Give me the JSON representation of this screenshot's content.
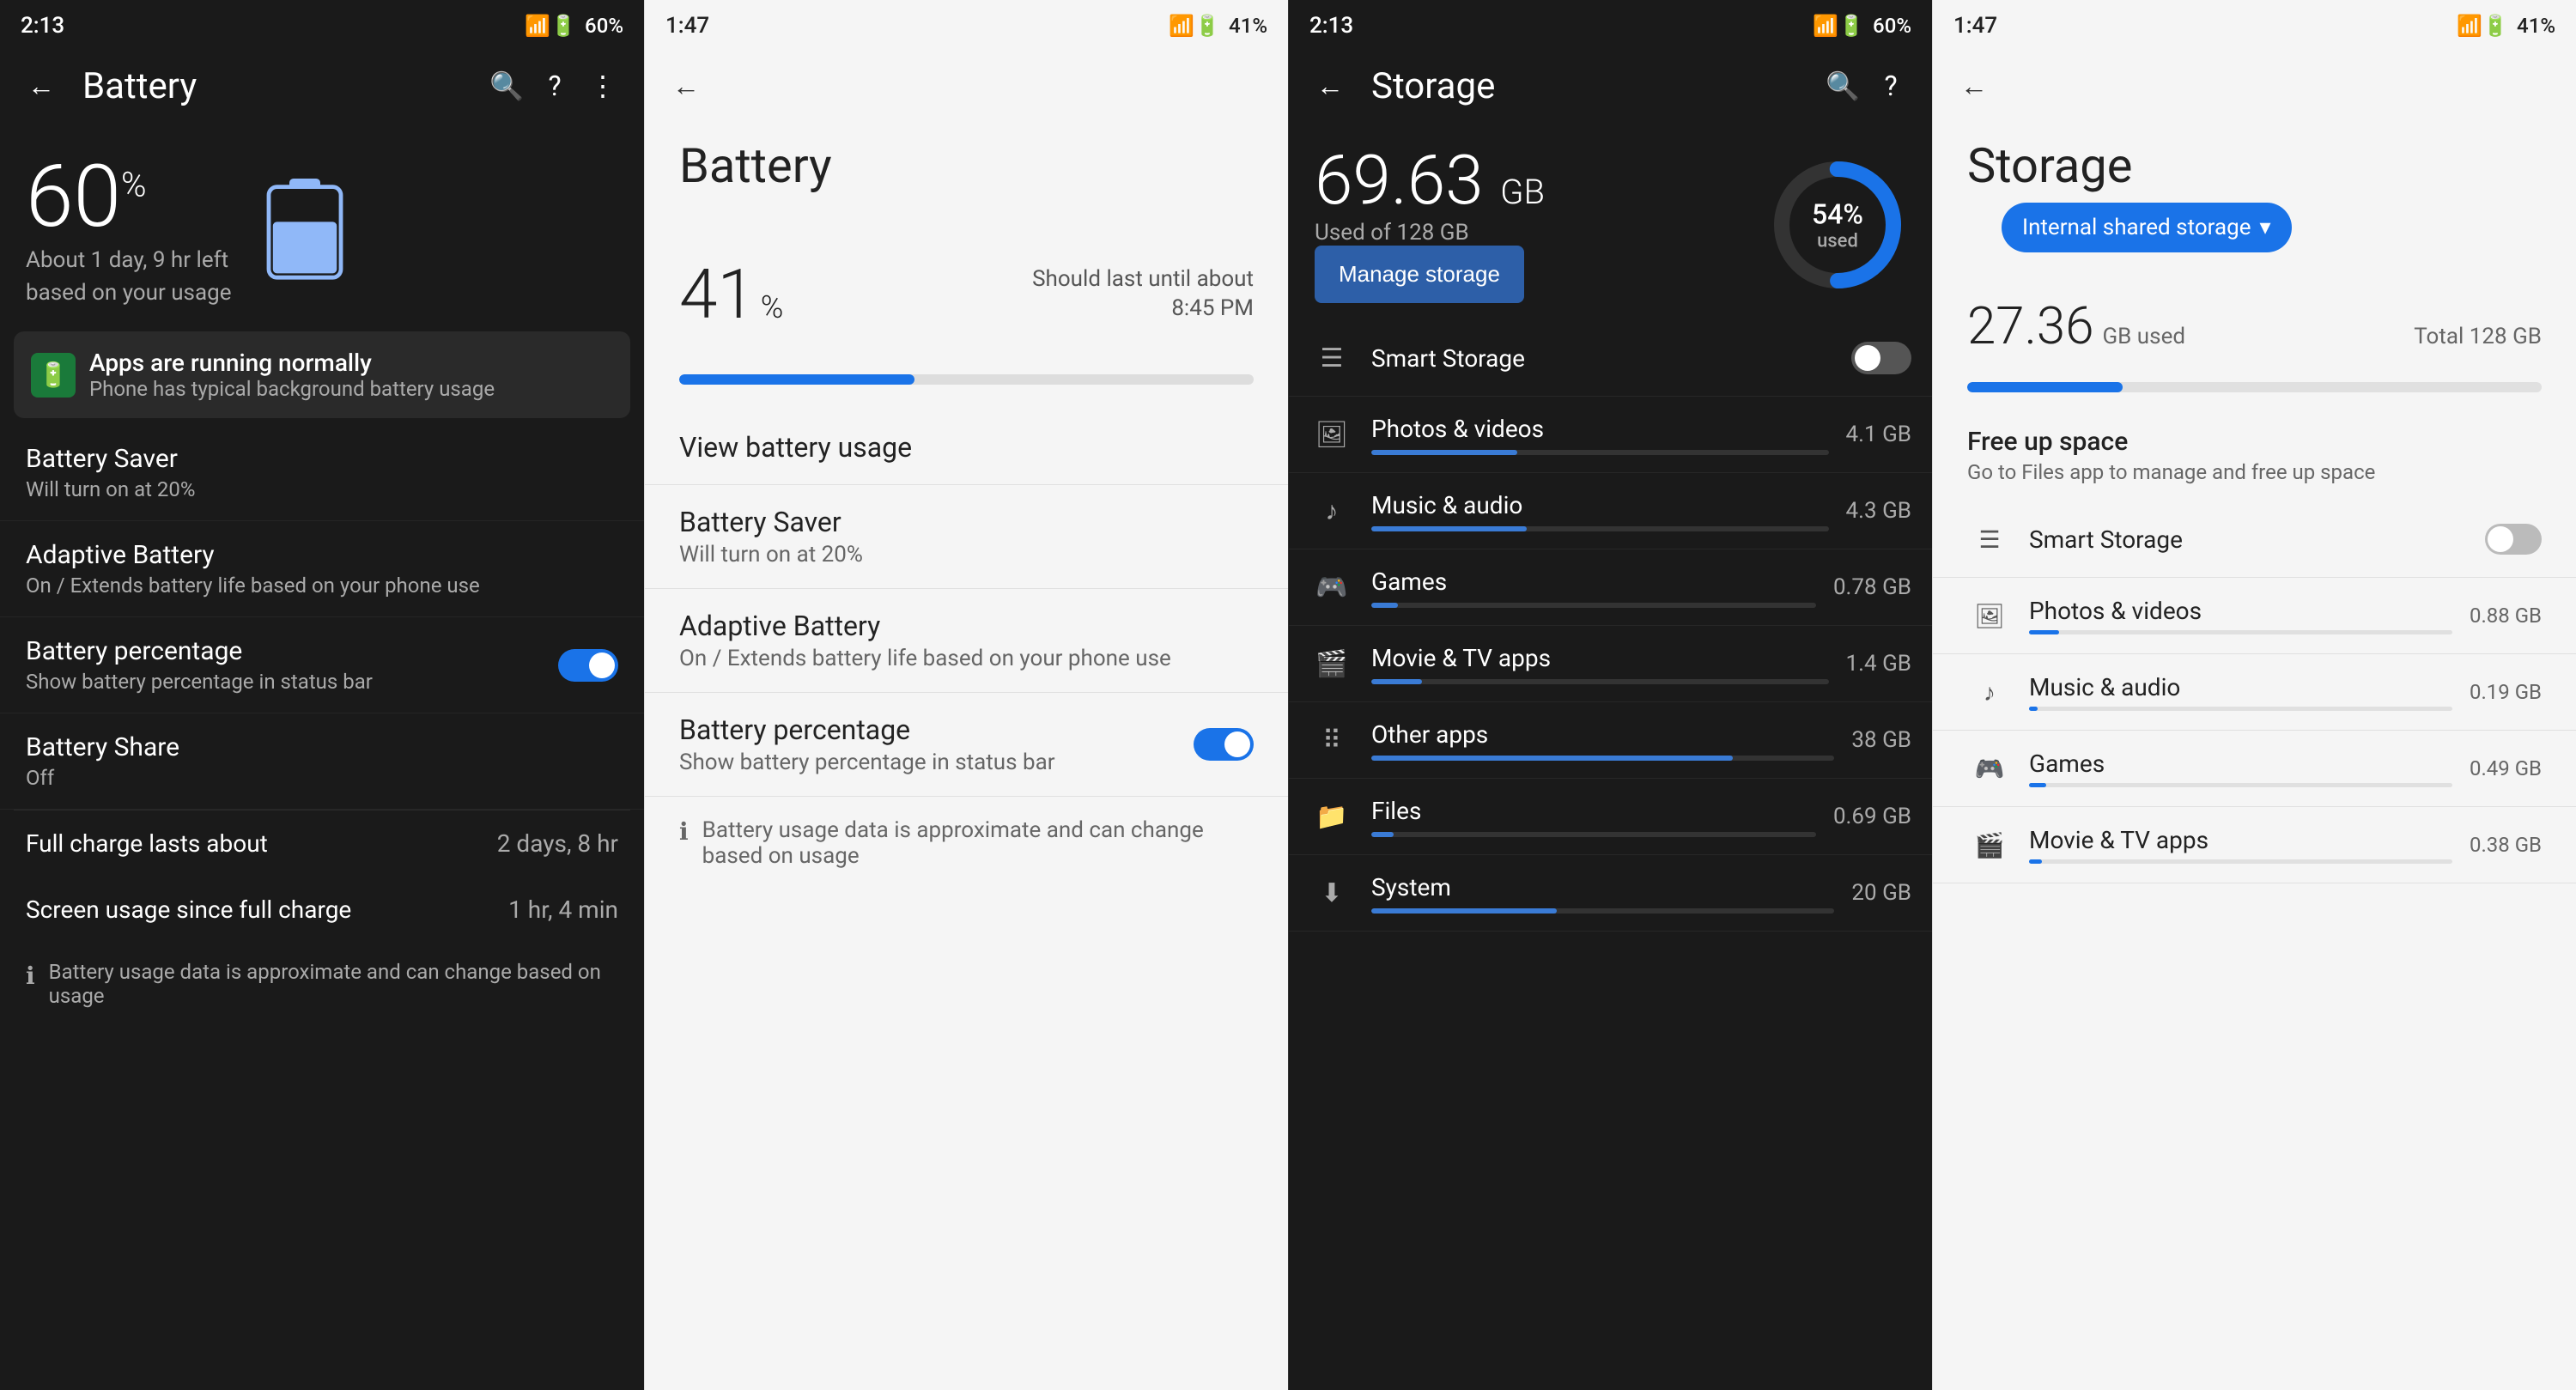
{
  "panel1": {
    "status_bar": {
      "time": "2:13",
      "battery": "60%"
    },
    "toolbar": {
      "back_label": "←",
      "title": "Battery",
      "search_icon": "🔍",
      "help_icon": "?",
      "more_icon": "⋮"
    },
    "hero": {
      "percent": "60",
      "symbol": "%",
      "subtitle1": "About 1 day, 9 hr left",
      "subtitle2": "based on your usage"
    },
    "status_card": {
      "title": "Apps are running normally",
      "subtitle": "Phone has typical background battery usage"
    },
    "items": [
      {
        "title": "Battery Saver",
        "subtitle": "Will turn on at 20%",
        "type": "nav"
      },
      {
        "title": "Adaptive Battery",
        "subtitle": "On / Extends battery life based on your phone use",
        "type": "nav"
      },
      {
        "title": "Battery percentage",
        "subtitle": "Show battery percentage in status bar",
        "type": "toggle",
        "toggle_on": true
      },
      {
        "title": "Battery Share",
        "subtitle": "Off",
        "type": "nav"
      }
    ],
    "full_charge": {
      "label": "Full charge lasts about",
      "value": "2 days, 8 hr"
    },
    "screen_usage": {
      "label": "Screen usage since full charge",
      "value": "1 hr, 4 min"
    },
    "footer": "Battery usage data is approximate and can change based on usage"
  },
  "panel2": {
    "status_bar": {
      "time": "1:47",
      "battery": "41%"
    },
    "toolbar": {
      "back_label": "←",
      "title": "Battery"
    },
    "hero": {
      "percent": "41",
      "symbol": "%",
      "last_until_label": "Should last until about",
      "last_until_time": "8:45 PM"
    },
    "progress": 41,
    "items": [
      {
        "title": "View battery usage",
        "subtitle": "",
        "type": "nav"
      },
      {
        "title": "Battery Saver",
        "subtitle": "Will turn on at 20%",
        "type": "nav"
      },
      {
        "title": "Adaptive Battery",
        "subtitle": "On / Extends battery life based on your phone use",
        "type": "nav"
      },
      {
        "title": "Battery percentage",
        "subtitle": "Show battery percentage in status bar",
        "type": "toggle",
        "toggle_on": true
      }
    ],
    "footer": "Battery usage data is approximate and can change based on usage"
  },
  "panel3": {
    "status_bar": {
      "time": "2:13",
      "battery": "60%"
    },
    "toolbar": {
      "back_label": "←",
      "title": "Storage",
      "search_icon": "🔍",
      "help_icon": "?"
    },
    "hero": {
      "used_gb": "69.63",
      "unit": "GB",
      "of_label": "Used of 128 GB",
      "percent": "54",
      "percent_label": "used",
      "manage_btn": "Manage storage"
    },
    "items": [
      {
        "icon": "☰",
        "title": "Smart Storage",
        "size": "",
        "type": "toggle",
        "bar_pct": 0,
        "bar_color": "#555"
      },
      {
        "icon": "🖼",
        "title": "Photos & videos",
        "size": "4.1 GB",
        "bar_pct": 32,
        "bar_color": "#3a7bd5"
      },
      {
        "icon": "♪",
        "title": "Music & audio",
        "size": "4.3 GB",
        "bar_pct": 34,
        "bar_color": "#3a7bd5"
      },
      {
        "icon": "🎮",
        "title": "Games",
        "size": "0.78 GB",
        "bar_pct": 6,
        "bar_color": "#3a7bd5"
      },
      {
        "icon": "🎬",
        "title": "Movie & TV apps",
        "size": "1.4 GB",
        "bar_pct": 11,
        "bar_color": "#3a7bd5"
      },
      {
        "icon": "⠿",
        "title": "Other apps",
        "size": "38 GB",
        "bar_pct": 78,
        "bar_color": "#3a7bd5"
      },
      {
        "icon": "📁",
        "title": "Files",
        "size": "0.69 GB",
        "bar_pct": 5,
        "bar_color": "#3a7bd5"
      },
      {
        "icon": "⬇",
        "title": "System",
        "size": "20 GB",
        "bar_pct": 40,
        "bar_color": "#3a7bd5"
      }
    ]
  },
  "panel4": {
    "status_bar": {
      "time": "1:47",
      "battery": "41%"
    },
    "toolbar": {
      "back_label": "←",
      "title": "Storage"
    },
    "chip": {
      "label": "Internal shared storage",
      "dropdown": "▾"
    },
    "storage": {
      "used_gb": "27.36",
      "unit": "GB used",
      "total": "Total 128 GB",
      "pct": 27
    },
    "free_up": {
      "title": "Free up space",
      "subtitle": "Go to Files app to manage and free up space"
    },
    "items": [
      {
        "icon": "☰",
        "title": "Smart Storage",
        "size": "",
        "type": "toggle",
        "bar_pct": 0,
        "bar_color": "#1a73e8"
      },
      {
        "icon": "🖼",
        "title": "Photos & videos",
        "size": "0.88 GB",
        "bar_pct": 7,
        "bar_color": "#1a73e8"
      },
      {
        "icon": "♪",
        "title": "Music & audio",
        "size": "0.19 GB",
        "bar_pct": 2,
        "bar_color": "#1a73e8"
      },
      {
        "icon": "🎮",
        "title": "Games",
        "size": "0.49 GB",
        "bar_pct": 4,
        "bar_color": "#1a73e8"
      },
      {
        "icon": "🎬",
        "title": "Movie & TV apps",
        "size": "0.38 GB",
        "bar_pct": 3,
        "bar_color": "#1a73e8"
      }
    ]
  }
}
